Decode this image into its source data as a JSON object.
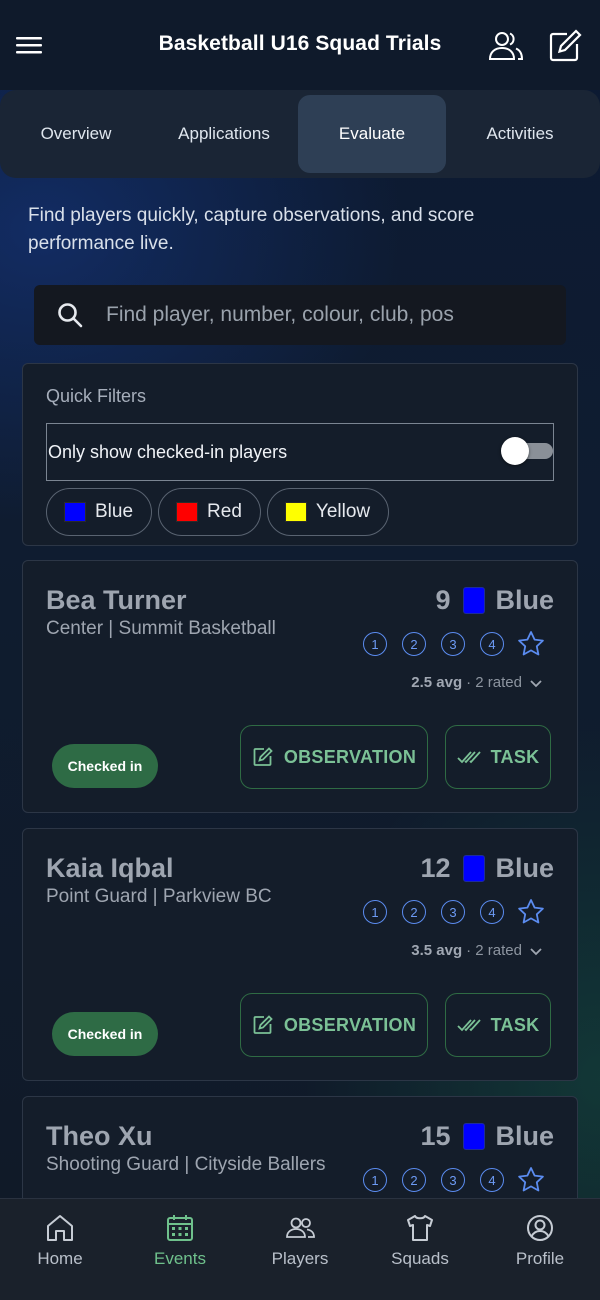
{
  "header": {
    "title": "Basketball U16 Squad Trials",
    "menu_icon": "hamburger-menu-icon",
    "people_icon": "people-icon",
    "edit_icon": "edit-square-icon"
  },
  "tabs": [
    {
      "label": "Overview",
      "active": false
    },
    {
      "label": "Applications",
      "active": false
    },
    {
      "label": "Evaluate",
      "active": true
    },
    {
      "label": "Activities",
      "active": false
    }
  ],
  "intro": "Find players quickly, capture observations, and score performance live.",
  "search": {
    "placeholder": "Find player, number, colour, club, pos",
    "value": ""
  },
  "filters": {
    "label": "Quick Filters",
    "checked_in_toggle": {
      "label": "Only show checked-in players",
      "on": false
    },
    "chips": [
      {
        "label": "Blue",
        "color": "#0000ff"
      },
      {
        "label": "Red",
        "color": "#ff0000"
      },
      {
        "label": "Yellow",
        "color": "#ffff00"
      }
    ]
  },
  "players": [
    {
      "name": "Bea Turner",
      "position_club": "Center | Summit Basketball",
      "number": "9",
      "color_label": "Blue",
      "color": "#0000ff",
      "ratings": [
        "1",
        "2",
        "3",
        "4"
      ],
      "avg": "2.5 avg",
      "rated": "· 2 rated",
      "status": "Checked in",
      "observation_label": "OBSERVATION",
      "task_label": "TASK"
    },
    {
      "name": "Kaia Iqbal",
      "position_club": "Point Guard | Parkview BC",
      "number": "12",
      "color_label": "Blue",
      "color": "#0000ff",
      "ratings": [
        "1",
        "2",
        "3",
        "4"
      ],
      "avg": "3.5 avg",
      "rated": "· 2 rated",
      "status": "Checked in",
      "observation_label": "OBSERVATION",
      "task_label": "TASK"
    },
    {
      "name": "Theo Xu",
      "position_club": "Shooting Guard | Cityside Ballers",
      "number": "15",
      "color_label": "Blue",
      "color": "#0000ff",
      "ratings": [
        "1",
        "2",
        "3",
        "4"
      ]
    }
  ],
  "bottom_nav": [
    {
      "label": "Home",
      "icon": "home-icon",
      "active": false
    },
    {
      "label": "Events",
      "icon": "calendar-icon",
      "active": true
    },
    {
      "label": "Players",
      "icon": "people-icon",
      "active": false
    },
    {
      "label": "Squads",
      "icon": "shirt-icon",
      "active": false
    },
    {
      "label": "Profile",
      "icon": "user-circle-icon",
      "active": false
    }
  ]
}
